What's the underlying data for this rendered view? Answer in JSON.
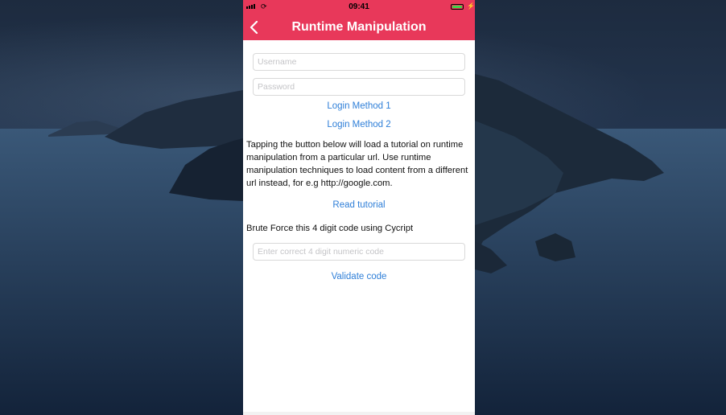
{
  "status_bar": {
    "time": "09:41",
    "signal_icon": "signal-bars-icon",
    "wifi_icon": "wifi-icon",
    "battery_icon": "battery-icon",
    "battery_level": 1.0,
    "battery_color": "#3fd548"
  },
  "nav": {
    "title": "Runtime Manipulation",
    "back_icon": "chevron-left-icon",
    "bar_color": "#e8385a"
  },
  "login": {
    "username_placeholder": "Username",
    "password_placeholder": "Password",
    "method1_label": "Login Method 1",
    "method2_label": "Login Method 2"
  },
  "tutorial": {
    "description": "Tapping the button below will load a tutorial on runtime manipulation from a particular url. Use runtime manipulation techniques to load content from a different url instead, for e.g http://google.com.",
    "read_label": "Read tutorial"
  },
  "brute_force": {
    "description": "Brute Force this 4 digit code using Cycript",
    "code_placeholder": "Enter correct 4 digit numeric code",
    "validate_label": "Validate code"
  },
  "colors": {
    "accent": "#e8385a",
    "link": "#2f7fd8"
  }
}
